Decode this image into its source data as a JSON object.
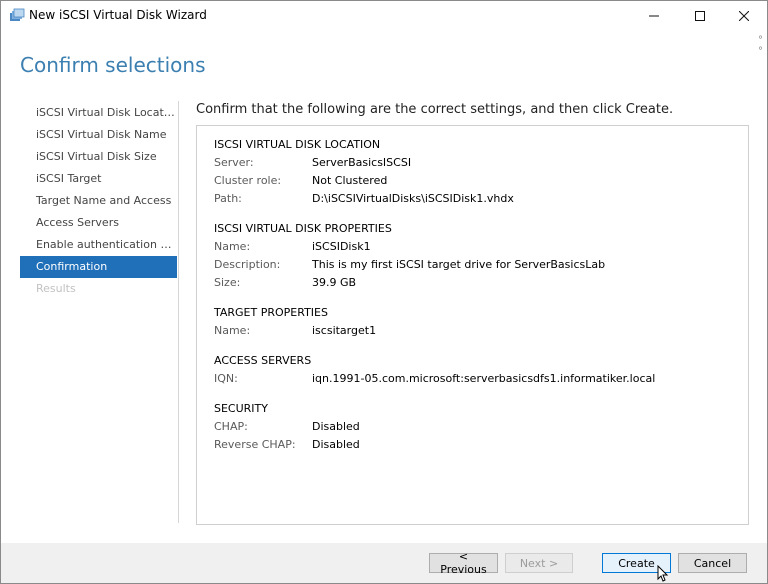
{
  "window": {
    "title": "New iSCSI Virtual Disk Wizard",
    "side_mark": "°°"
  },
  "page_title": "Confirm selections",
  "nav": {
    "items": [
      {
        "label": "iSCSI Virtual Disk Location",
        "state": "normal"
      },
      {
        "label": "iSCSI Virtual Disk Name",
        "state": "normal"
      },
      {
        "label": "iSCSI Virtual Disk Size",
        "state": "normal"
      },
      {
        "label": "iSCSI Target",
        "state": "normal"
      },
      {
        "label": "Target Name and Access",
        "state": "normal"
      },
      {
        "label": "Access Servers",
        "state": "normal"
      },
      {
        "label": "Enable authentication ser...",
        "state": "normal"
      },
      {
        "label": "Confirmation",
        "state": "active"
      },
      {
        "label": "Results",
        "state": "disabled"
      }
    ]
  },
  "intro_text": "Confirm that the following are the correct settings, and then click Create.",
  "sections": [
    {
      "heading": "ISCSI VIRTUAL DISK LOCATION",
      "rows": [
        {
          "key": "Server:",
          "value": "ServerBasicsISCSI"
        },
        {
          "key": "Cluster role:",
          "value": "Not Clustered"
        },
        {
          "key": "Path:",
          "value": "D:\\iSCSIVirtualDisks\\iSCSIDisk1.vhdx"
        }
      ]
    },
    {
      "heading": "ISCSI VIRTUAL DISK PROPERTIES",
      "rows": [
        {
          "key": "Name:",
          "value": "iSCSIDisk1"
        },
        {
          "key": "Description:",
          "value": "This is my first iSCSI target drive for ServerBasicsLab"
        },
        {
          "key": "Size:",
          "value": "39.9 GB"
        }
      ]
    },
    {
      "heading": "TARGET PROPERTIES",
      "rows": [
        {
          "key": "Name:",
          "value": "iscsitarget1"
        }
      ]
    },
    {
      "heading": "ACCESS SERVERS",
      "rows": [
        {
          "key": "IQN:",
          "value": "iqn.1991-05.com.microsoft:serverbasicsdfs1.informatiker.local"
        }
      ]
    },
    {
      "heading": "SECURITY",
      "rows": [
        {
          "key": "CHAP:",
          "value": "Disabled"
        },
        {
          "key": "Reverse CHAP:",
          "value": "Disabled"
        }
      ]
    }
  ],
  "buttons": {
    "previous": "< Previous",
    "next": "Next >",
    "create": "Create",
    "cancel": "Cancel"
  },
  "colors": {
    "title_blue": "#3c7fb1",
    "selection_blue": "#1f6fb9",
    "default_button_border": "#0078d7"
  }
}
